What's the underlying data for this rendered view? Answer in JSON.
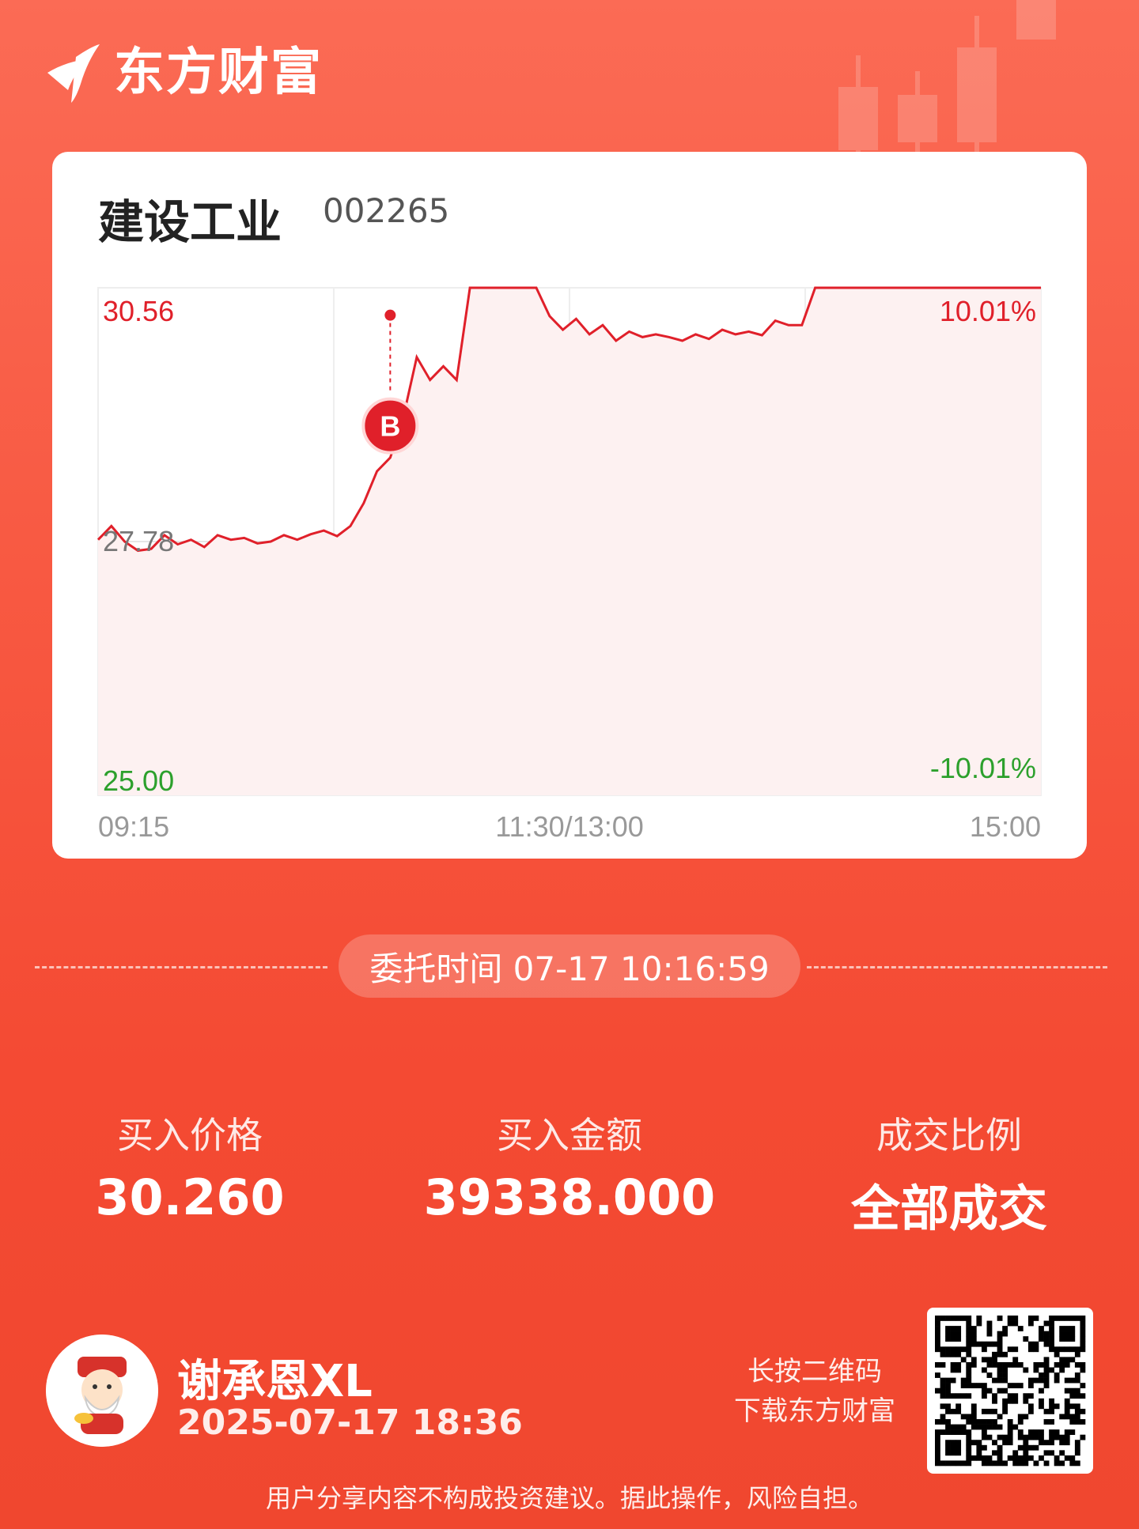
{
  "brand": {
    "name": "东方财富"
  },
  "stock": {
    "name": "建设工业",
    "code": "002265"
  },
  "chart_data": {
    "type": "line",
    "y_labels": {
      "top": "30.56",
      "mid": "27.78",
      "bottom": "25.00"
    },
    "pct_labels": {
      "top": "10.01%",
      "bottom": "-10.01%"
    },
    "x_labels": [
      "09:15",
      "11:30/13:00",
      "15:00"
    ],
    "ylim": [
      25.0,
      30.56
    ],
    "prev_close": 27.78,
    "series": [
      {
        "values": [
          27.8,
          27.95,
          27.78,
          27.68,
          27.7,
          27.85,
          27.75,
          27.8,
          27.72,
          27.85,
          27.8,
          27.82,
          27.76,
          27.78,
          27.85,
          27.8,
          27.86,
          27.9,
          27.84,
          27.95,
          28.2,
          28.55,
          28.7,
          29.15,
          29.8,
          29.55,
          29.7,
          29.55,
          30.56,
          30.56,
          30.56,
          30.56,
          30.56,
          30.56,
          30.25,
          30.1,
          30.22,
          30.05,
          30.15,
          29.98,
          30.08,
          30.02,
          30.05,
          30.02,
          29.98,
          30.05,
          30.0,
          30.1,
          30.05,
          30.08,
          30.04,
          30.2,
          30.15,
          30.15,
          30.56,
          30.56,
          30.56,
          30.56,
          30.56,
          30.56,
          30.56,
          30.56,
          30.56,
          30.56,
          30.56,
          30.56,
          30.56,
          30.56,
          30.56,
          30.56,
          30.56,
          30.56
        ]
      }
    ],
    "marker": {
      "label": "B",
      "price": 30.26,
      "index": 22
    }
  },
  "order": {
    "time_label": "委托时间 07-17 10:16:59"
  },
  "stats": [
    {
      "label": "买入价格",
      "value": "30.260"
    },
    {
      "label": "买入金额",
      "value": "39338.000"
    },
    {
      "label": "成交比例",
      "value": "全部成交"
    }
  ],
  "user": {
    "name": "谢承恩XL",
    "date": "2025-07-17 18:36"
  },
  "qr_hint": {
    "line1": "长按二维码",
    "line2": "下载东方财富"
  },
  "disclaimer": "用户分享内容不构成投资建议。据此操作，风险自担。",
  "colors": {
    "up": "#e0202a",
    "down": "#2ca02c",
    "fill": "#fdf1f1"
  }
}
